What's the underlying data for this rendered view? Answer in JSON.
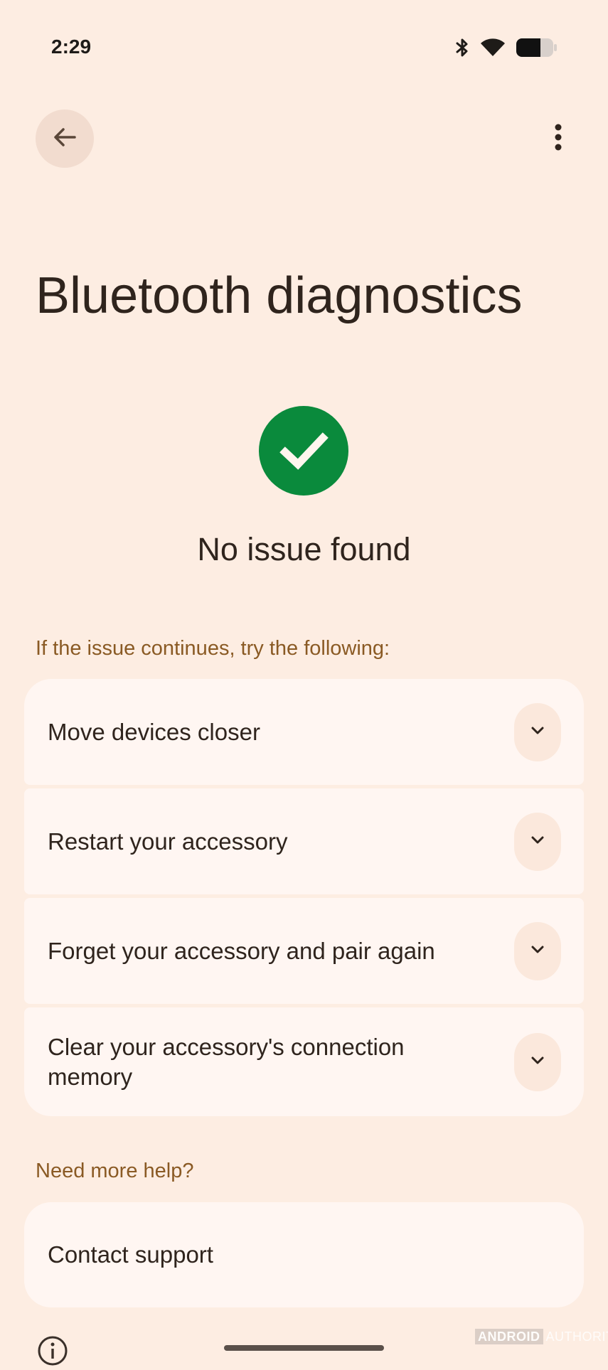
{
  "status_bar": {
    "time": "2:29",
    "icons": [
      "bluetooth-icon",
      "wifi-icon",
      "battery-icon"
    ]
  },
  "toolbar": {
    "back_icon": "arrow-back-icon",
    "more_icon": "more-vert-icon"
  },
  "page": {
    "title": "Bluetooth diagnostics"
  },
  "result": {
    "icon": "check-circle-icon",
    "text": "No issue found",
    "color": "#0a8a3c"
  },
  "tips": {
    "heading": "If the issue continues, try the following:",
    "items": [
      {
        "label": "Move devices closer",
        "icon": "chevron-down-icon"
      },
      {
        "label": "Restart your accessory",
        "icon": "chevron-down-icon"
      },
      {
        "label": "Forget your accessory and pair again",
        "icon": "chevron-down-icon"
      },
      {
        "label": "Clear your accessory's connection memory",
        "icon": "chevron-down-icon"
      }
    ]
  },
  "help": {
    "heading": "Need more help?",
    "contact_label": "Contact support"
  },
  "footer": {
    "info_icon": "info-icon"
  },
  "watermark": {
    "brand": "ANDROID",
    "suffix": "AUTHORITY"
  },
  "colors": {
    "background": "#fdede2",
    "card": "#fff6f2",
    "accent_text": "#8a5a24",
    "success": "#0a8a3c"
  }
}
